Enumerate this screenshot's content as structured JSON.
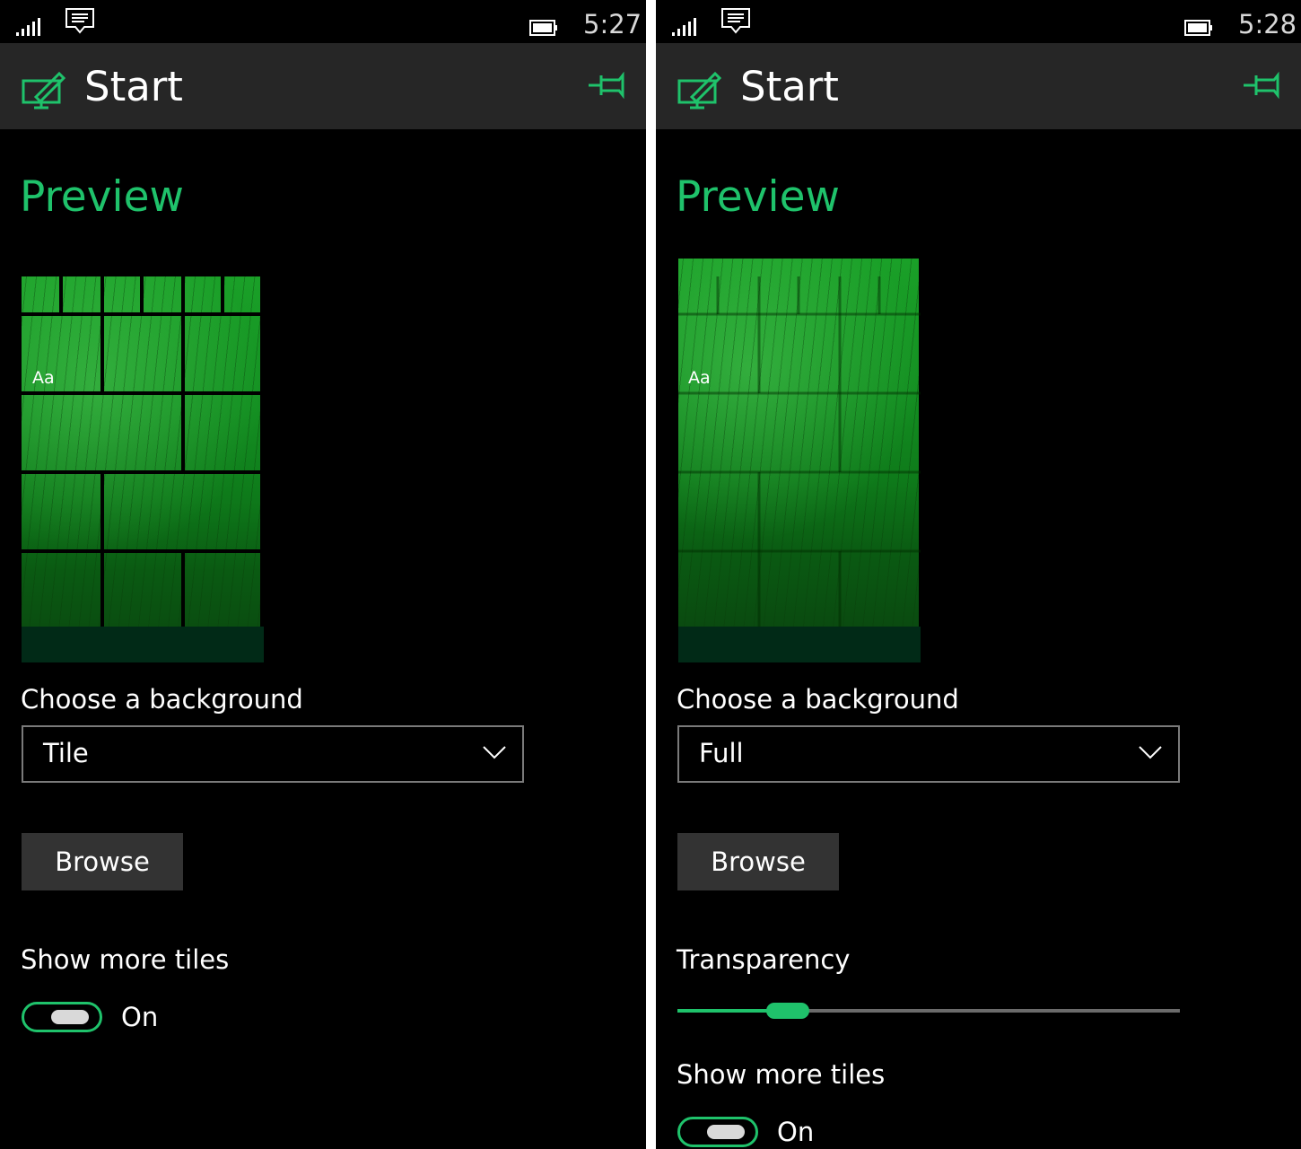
{
  "theme": {
    "accent": "#1fc26b",
    "background": "#000000",
    "header": "#262626",
    "button": "#333333"
  },
  "left": {
    "status": {
      "time": "5:27",
      "icons": [
        "signal-icon",
        "message-icon",
        "battery-icon"
      ]
    },
    "header": {
      "title": "Start",
      "app_icon": "personalize-icon",
      "pin_icon": "pin-icon"
    },
    "preview_title": "Preview",
    "preview": {
      "tile_label": "Aa",
      "mode": "tile"
    },
    "background_label": "Choose a background",
    "background_select": {
      "value": "Tile",
      "chevron_icon": "chevron-down-icon"
    },
    "browse_label": "Browse",
    "more_tiles_label": "Show more tiles",
    "more_tiles_state": "On"
  },
  "right": {
    "status": {
      "time": "5:28",
      "icons": [
        "signal-icon",
        "message-icon",
        "battery-icon"
      ]
    },
    "header": {
      "title": "Start",
      "app_icon": "personalize-icon",
      "pin_icon": "pin-icon"
    },
    "preview_title": "Preview",
    "preview": {
      "tile_label": "Aa",
      "mode": "full"
    },
    "background_label": "Choose a background",
    "background_select": {
      "value": "Full",
      "chevron_icon": "chevron-down-icon"
    },
    "browse_label": "Browse",
    "transparency_label": "Transparency",
    "transparency_value": 0.22,
    "more_tiles_label": "Show more tiles",
    "more_tiles_state": "On"
  }
}
